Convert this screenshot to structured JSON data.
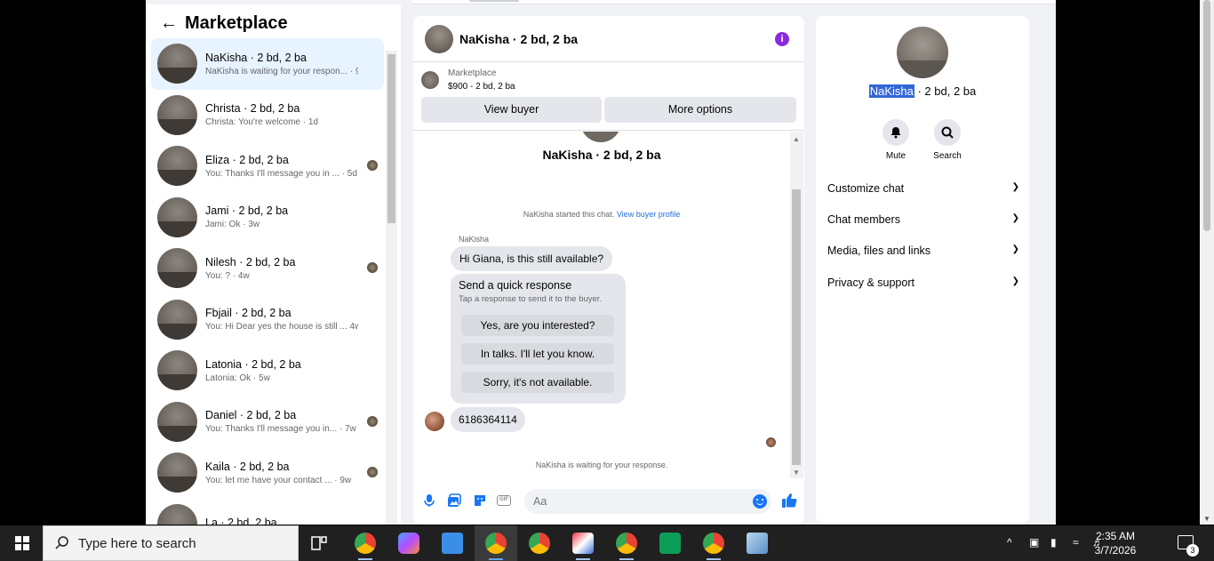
{
  "left": {
    "title": "Marketplace",
    "conversations": [
      {
        "name": "NaKisha · 2 bd, 2 ba",
        "snippet": "NaKisha is waiting for your respon... · 9h",
        "active": true
      },
      {
        "name": "Christa · 2 bd, 2 ba",
        "snippet": "Christa: You're welcome · 1d"
      },
      {
        "name": "Eliza · 2 bd, 2 ba",
        "snippet": "You: Thanks I'll message you in ... · 5d"
      },
      {
        "name": "Jami · 2 bd, 2 ba",
        "snippet": "Jami: Ok · 3w"
      },
      {
        "name": "Nilesh · 2 bd, 2 ba",
        "snippet": "You: ? · 4w"
      },
      {
        "name": "Fbjail · 2 bd, 2 ba",
        "snippet": "You: Hi Dear yes the house is still ...   4w"
      },
      {
        "name": "Latonia · 2 bd, 2 ba",
        "snippet": "Latonia: Ok · 5w"
      },
      {
        "name": "Daniel · 2 bd, 2 ba",
        "snippet": "You: Thanks I'll message you in... · 7w"
      },
      {
        "name": "Kaila · 2 bd, 2 ba",
        "snippet": "You: let me have your contact ... · 9w"
      },
      {
        "name": "La · 2 bd, 2 ba",
        "snippet": ""
      }
    ]
  },
  "chat": {
    "header_title": "NaKisha · 2 bd, 2 ba",
    "listing_label": "Marketplace",
    "listing_detail": "$900 - 2 bd, 2 ba",
    "view_buyer_label": "View buyer",
    "more_options_label": "More options",
    "chat_name": "NaKisha · 2 bd, 2 ba",
    "started_text": "NaKisha started this chat.",
    "view_buyer_profile": "View buyer profile",
    "sender_name": "NaKisha",
    "message_1": "Hi Giana, is this still available?",
    "quick_title": "Send a quick response",
    "quick_subtitle": "Tap a response to send it to the buyer.",
    "quick_options": [
      "Yes, are you interested?",
      "In talks. I'll let you know.",
      "Sorry, it's not available."
    ],
    "message_2": "6186364114",
    "waiting_text": "NaKisha is waiting for your response.",
    "composer_placeholder": "Aa",
    "gif_label": "GIF"
  },
  "right": {
    "name_highlight": "NaKisha",
    "name_rest": " · 2 bd, 2 ba",
    "mute_label": "Mute",
    "search_label": "Search",
    "sections": [
      "Customize chat",
      "Chat members",
      "Media, files and links",
      "Privacy & support"
    ]
  },
  "taskbar": {
    "search_placeholder": "Type here to search",
    "time": "2:35 AM",
    "date": "3/7/2026",
    "notification_count": "3"
  },
  "colors": {
    "accent": "#1877f2",
    "info_purple": "#8a2be2",
    "active_row": "#e7f3ff",
    "link": "#216fdb"
  }
}
